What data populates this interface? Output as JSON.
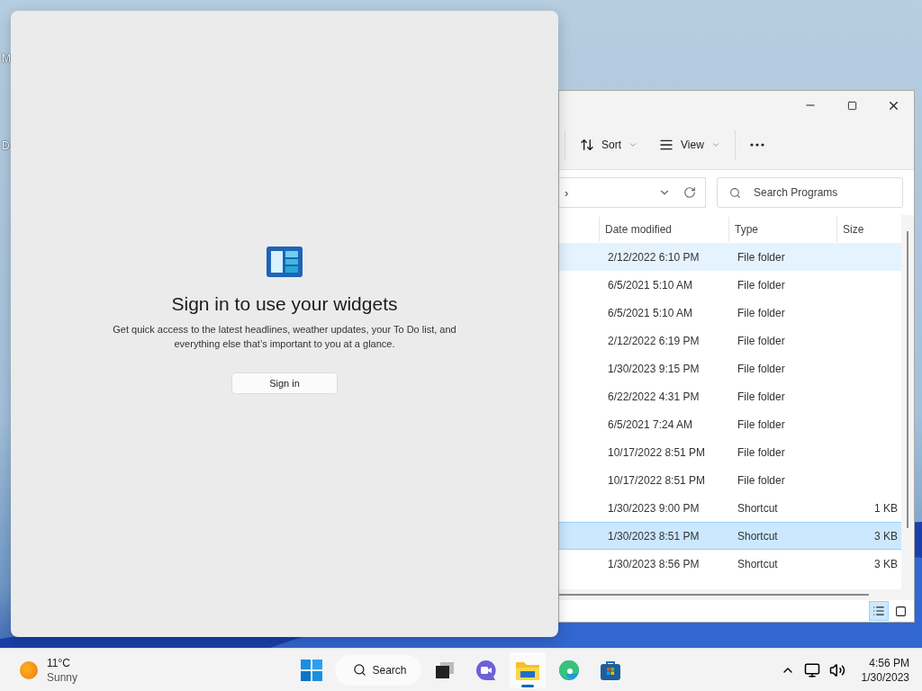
{
  "desktop": {
    "icon_labels": [
      "M",
      "D"
    ]
  },
  "widgets_panel": {
    "title": "Sign in to use your widgets",
    "description": "Get quick access to the latest headlines, weather updates, your To Do list, and everything else that’s important to you at a glance.",
    "button": "Sign in"
  },
  "explorer": {
    "toolbar": [
      {
        "kind": "sort",
        "label": "Sort"
      },
      {
        "kind": "view",
        "label": "View"
      }
    ],
    "address_path": "›",
    "search": {
      "placeholder": "Search Programs"
    },
    "columns": [
      "Date modified",
      "Type",
      "Size"
    ],
    "rows": [
      {
        "date": "2/12/2022 6:10 PM",
        "type": "File folder",
        "selected": false,
        "hovered": true
      },
      {
        "date": "6/5/2021 5:10 AM",
        "type": "File folder",
        "selected": false,
        "hovered": false
      },
      {
        "date": "6/5/2021 5:10 AM",
        "type": "File folder",
        "selected": false,
        "hovered": false
      },
      {
        "date": "2/12/2022 6:19 PM",
        "type": "File folder",
        "selected": false,
        "hovered": false
      },
      {
        "date": "1/30/2023 9:15 PM",
        "type": "File folder",
        "selected": false,
        "hovered": false
      },
      {
        "date": "6/22/2022 4:31 PM",
        "type": "File folder",
        "selected": false,
        "hovered": false
      },
      {
        "date": "6/5/2021 7:24 AM",
        "type": "File folder",
        "selected": false,
        "hovered": false
      },
      {
        "date": "10/17/2022 8:51 PM",
        "type": "File folder",
        "selected": false,
        "hovered": false
      },
      {
        "date": "10/17/2022 8:51 PM",
        "type": "File folder",
        "selected": false,
        "hovered": false
      },
      {
        "date": "1/30/2023 9:00 PM",
        "type": "Shortcut",
        "size": "1 KB",
        "selected": false,
        "hovered": false
      },
      {
        "date": "1/30/2023 8:51 PM",
        "type": "Shortcut",
        "size": "3 KB",
        "selected": true,
        "hovered": false
      },
      {
        "date": "1/30/2023 8:56 PM",
        "type": "Shortcut",
        "size": "3 KB",
        "selected": false,
        "hovered": false
      }
    ],
    "view_buttons": [
      {
        "kind": "details",
        "selected": true
      },
      {
        "kind": "tiles",
        "selected": false
      }
    ]
  },
  "taskbar": {
    "weather": {
      "temperature": "11°C",
      "condition": "Sunny"
    },
    "search": "Search",
    "apps": [
      {
        "kind": "start",
        "active": false
      },
      {
        "kind": "search"
      },
      {
        "kind": "taskview",
        "active": false
      },
      {
        "kind": "chat",
        "active": false
      },
      {
        "kind": "explorer",
        "active": true
      },
      {
        "kind": "edge",
        "active": false
      },
      {
        "kind": "store",
        "active": false
      }
    ],
    "clock": {
      "time": "4:56 PM",
      "date": "1/30/2023"
    }
  }
}
